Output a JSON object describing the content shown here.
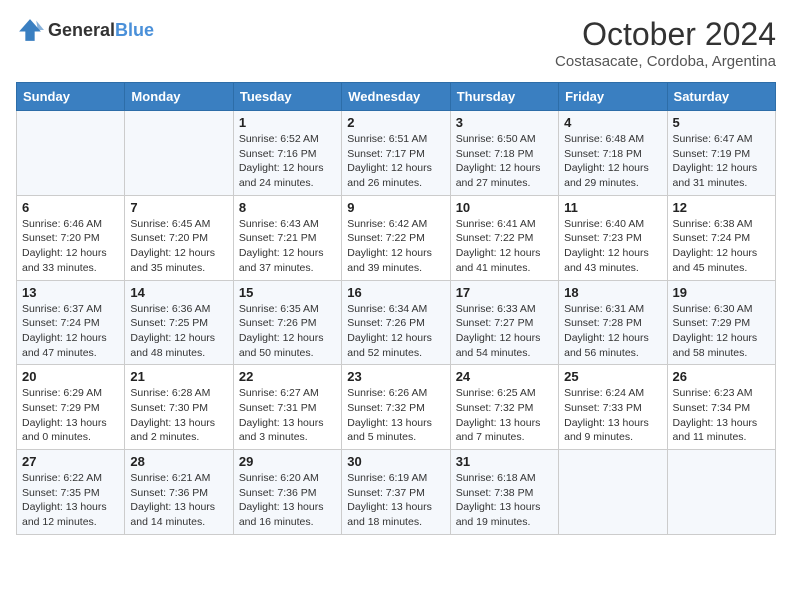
{
  "header": {
    "logo_general": "General",
    "logo_blue": "Blue",
    "title": "October 2024",
    "subtitle": "Costasacate, Cordoba, Argentina"
  },
  "days_of_week": [
    "Sunday",
    "Monday",
    "Tuesday",
    "Wednesday",
    "Thursday",
    "Friday",
    "Saturday"
  ],
  "weeks": [
    [
      {
        "day": "",
        "detail": ""
      },
      {
        "day": "",
        "detail": ""
      },
      {
        "day": "1",
        "detail": "Sunrise: 6:52 AM\nSunset: 7:16 PM\nDaylight: 12 hours and 24 minutes."
      },
      {
        "day": "2",
        "detail": "Sunrise: 6:51 AM\nSunset: 7:17 PM\nDaylight: 12 hours and 26 minutes."
      },
      {
        "day": "3",
        "detail": "Sunrise: 6:50 AM\nSunset: 7:18 PM\nDaylight: 12 hours and 27 minutes."
      },
      {
        "day": "4",
        "detail": "Sunrise: 6:48 AM\nSunset: 7:18 PM\nDaylight: 12 hours and 29 minutes."
      },
      {
        "day": "5",
        "detail": "Sunrise: 6:47 AM\nSunset: 7:19 PM\nDaylight: 12 hours and 31 minutes."
      }
    ],
    [
      {
        "day": "6",
        "detail": "Sunrise: 6:46 AM\nSunset: 7:20 PM\nDaylight: 12 hours and 33 minutes."
      },
      {
        "day": "7",
        "detail": "Sunrise: 6:45 AM\nSunset: 7:20 PM\nDaylight: 12 hours and 35 minutes."
      },
      {
        "day": "8",
        "detail": "Sunrise: 6:43 AM\nSunset: 7:21 PM\nDaylight: 12 hours and 37 minutes."
      },
      {
        "day": "9",
        "detail": "Sunrise: 6:42 AM\nSunset: 7:22 PM\nDaylight: 12 hours and 39 minutes."
      },
      {
        "day": "10",
        "detail": "Sunrise: 6:41 AM\nSunset: 7:22 PM\nDaylight: 12 hours and 41 minutes."
      },
      {
        "day": "11",
        "detail": "Sunrise: 6:40 AM\nSunset: 7:23 PM\nDaylight: 12 hours and 43 minutes."
      },
      {
        "day": "12",
        "detail": "Sunrise: 6:38 AM\nSunset: 7:24 PM\nDaylight: 12 hours and 45 minutes."
      }
    ],
    [
      {
        "day": "13",
        "detail": "Sunrise: 6:37 AM\nSunset: 7:24 PM\nDaylight: 12 hours and 47 minutes."
      },
      {
        "day": "14",
        "detail": "Sunrise: 6:36 AM\nSunset: 7:25 PM\nDaylight: 12 hours and 48 minutes."
      },
      {
        "day": "15",
        "detail": "Sunrise: 6:35 AM\nSunset: 7:26 PM\nDaylight: 12 hours and 50 minutes."
      },
      {
        "day": "16",
        "detail": "Sunrise: 6:34 AM\nSunset: 7:26 PM\nDaylight: 12 hours and 52 minutes."
      },
      {
        "day": "17",
        "detail": "Sunrise: 6:33 AM\nSunset: 7:27 PM\nDaylight: 12 hours and 54 minutes."
      },
      {
        "day": "18",
        "detail": "Sunrise: 6:31 AM\nSunset: 7:28 PM\nDaylight: 12 hours and 56 minutes."
      },
      {
        "day": "19",
        "detail": "Sunrise: 6:30 AM\nSunset: 7:29 PM\nDaylight: 12 hours and 58 minutes."
      }
    ],
    [
      {
        "day": "20",
        "detail": "Sunrise: 6:29 AM\nSunset: 7:29 PM\nDaylight: 13 hours and 0 minutes."
      },
      {
        "day": "21",
        "detail": "Sunrise: 6:28 AM\nSunset: 7:30 PM\nDaylight: 13 hours and 2 minutes."
      },
      {
        "day": "22",
        "detail": "Sunrise: 6:27 AM\nSunset: 7:31 PM\nDaylight: 13 hours and 3 minutes."
      },
      {
        "day": "23",
        "detail": "Sunrise: 6:26 AM\nSunset: 7:32 PM\nDaylight: 13 hours and 5 minutes."
      },
      {
        "day": "24",
        "detail": "Sunrise: 6:25 AM\nSunset: 7:32 PM\nDaylight: 13 hours and 7 minutes."
      },
      {
        "day": "25",
        "detail": "Sunrise: 6:24 AM\nSunset: 7:33 PM\nDaylight: 13 hours and 9 minutes."
      },
      {
        "day": "26",
        "detail": "Sunrise: 6:23 AM\nSunset: 7:34 PM\nDaylight: 13 hours and 11 minutes."
      }
    ],
    [
      {
        "day": "27",
        "detail": "Sunrise: 6:22 AM\nSunset: 7:35 PM\nDaylight: 13 hours and 12 minutes."
      },
      {
        "day": "28",
        "detail": "Sunrise: 6:21 AM\nSunset: 7:36 PM\nDaylight: 13 hours and 14 minutes."
      },
      {
        "day": "29",
        "detail": "Sunrise: 6:20 AM\nSunset: 7:36 PM\nDaylight: 13 hours and 16 minutes."
      },
      {
        "day": "30",
        "detail": "Sunrise: 6:19 AM\nSunset: 7:37 PM\nDaylight: 13 hours and 18 minutes."
      },
      {
        "day": "31",
        "detail": "Sunrise: 6:18 AM\nSunset: 7:38 PM\nDaylight: 13 hours and 19 minutes."
      },
      {
        "day": "",
        "detail": ""
      },
      {
        "day": "",
        "detail": ""
      }
    ]
  ]
}
